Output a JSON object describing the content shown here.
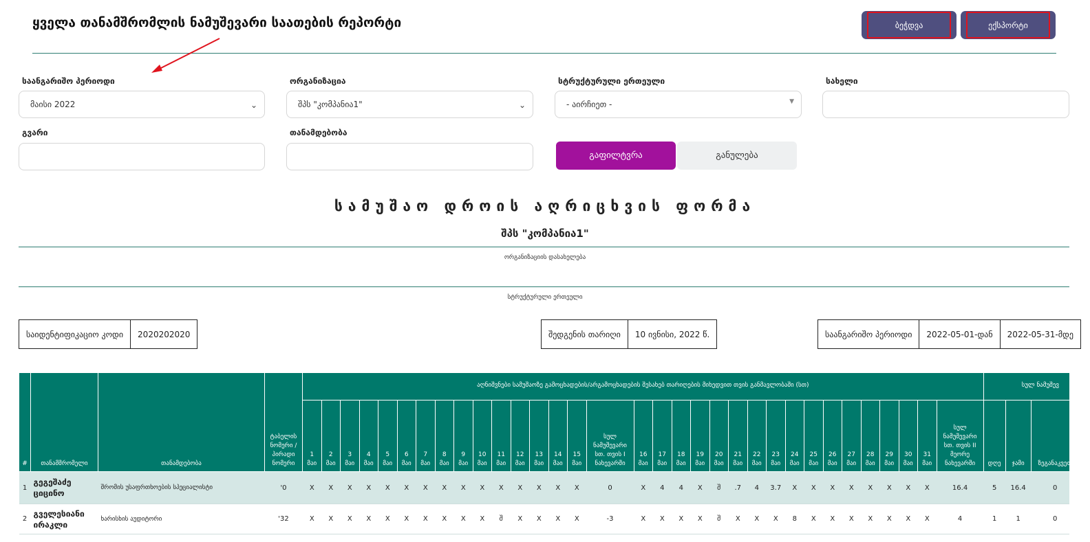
{
  "header": {
    "title": "ყველა თანამშრომლის ნამუშევარი საათების რეპორტი",
    "print_label": "ბეჭდვა",
    "export_label": "ექსპორტი"
  },
  "filters": {
    "period_label": "საანგარიშო პერიოდი",
    "period_value": "მაისი 2022",
    "org_label": "ორგანიზაცია",
    "org_value": "შპს \"კომპანია1\"",
    "unit_label": "სტრუქტურული ერთეული",
    "unit_value": "- აირჩიეთ -",
    "name_label": "სახელი",
    "name_value": "",
    "surname_label": "გვარი",
    "surname_value": "",
    "position_label": "თანამდებობა",
    "position_value": "",
    "filter_button": "გაფილტვრა",
    "reset_button": "განულება"
  },
  "form": {
    "title": "სამუშაო დროის აღრიცხვის ფორმა",
    "org_name": "შპს \"კომპანია1\"",
    "org_caption": "ორგანიზაციის დასახელება",
    "unit_caption": "სტრუქტურული ერთეული"
  },
  "info": {
    "id_label": "საიდენტიფიკაციო კოდი",
    "id_value": "2020202020",
    "date_label": "შედგენის თარიღი",
    "date_value": "10 ივნისი, 2022 წ.",
    "period_label": "საანგარიშო პერიოდი",
    "period_from": "2022-05-01-დან",
    "period_to": "2022-05-31-მდე"
  },
  "table": {
    "col_num": "#",
    "col_employee": "თანამშრომელი",
    "col_position": "თანამდებობა",
    "col_tabel": "ტაბელის ნომერი / პირადი ნომერი",
    "group_header": "აღნიშვნები სამუშაოზე გამოცხადების/არგამოცხადების შესახებ თარიღების მიხედვით თვის განმავლობაში (სთ)",
    "group_header2": "სულ ნამუშევ",
    "month_abbr": "მაი",
    "first_half_total": "სულ ნამუშევარი სთ. თვის I ნახევარში",
    "second_half_total": "სულ ნამუშევარი სთ. თვის II მეორე ნახევარში",
    "col_day": "დღე",
    "col_hours": "ჯამი",
    "col_overtime": "ზეგანაკვეთ",
    "rows": [
      {
        "num": "1",
        "name": "გეგეშაძე ციცინო",
        "position": "შრომის უსაფრთხოების სპეციალისტი",
        "tabel": "'0",
        "first": [
          "X",
          "X",
          "X",
          "X",
          "X",
          "X",
          "X",
          "X",
          "X",
          "X",
          "X",
          "X",
          "X",
          "X",
          "X"
        ],
        "first_total": "0",
        "second": [
          "X",
          "4",
          "4",
          "X",
          "შ",
          ".7",
          "4",
          "3.7",
          "X",
          "X",
          "X",
          "X",
          "X",
          "X",
          "X",
          "X"
        ],
        "second_total": "16.4",
        "day": "5",
        "hours": "16.4",
        "overtime": "0"
      },
      {
        "num": "2",
        "name": "გველესიანი ირაკლი",
        "position": "ხარისხის აუდიტორი",
        "tabel": "'32",
        "first": [
          "X",
          "X",
          "X",
          "X",
          "X",
          "X",
          "X",
          "X",
          "X",
          "X",
          "შ",
          "X",
          "X",
          "X",
          "X"
        ],
        "first_total": "-3",
        "second": [
          "X",
          "X",
          "X",
          "X",
          "შ",
          "X",
          "X",
          "X",
          "8",
          "X",
          "X",
          "X",
          "X",
          "X",
          "X",
          "X"
        ],
        "second_total": "4",
        "day": "1",
        "hours": "1",
        "overtime": "0"
      }
    ]
  }
}
